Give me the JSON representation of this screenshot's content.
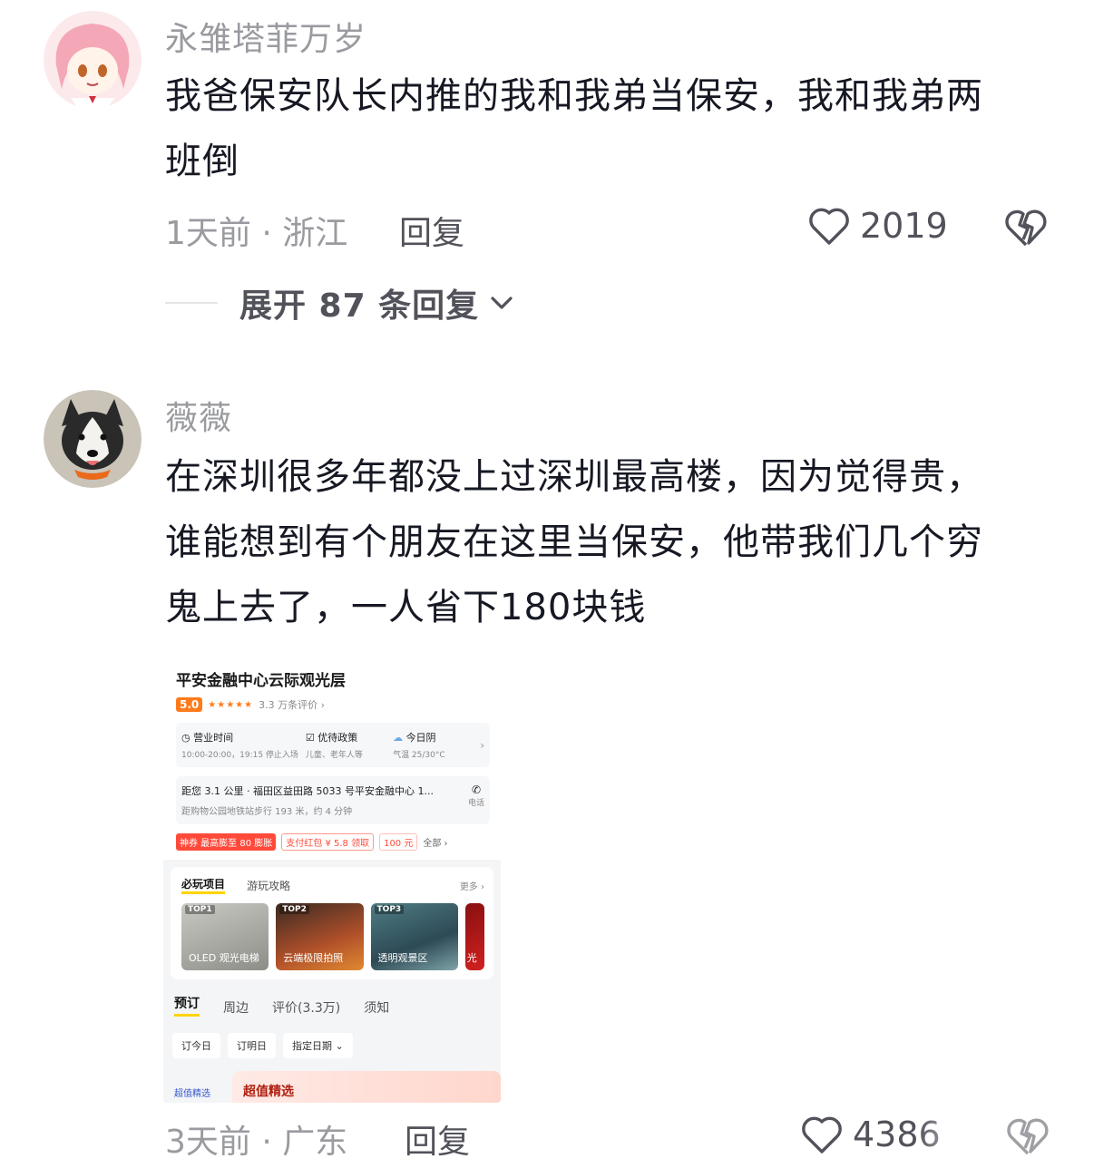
{
  "comments": [
    {
      "username": "永雏塔菲万岁",
      "text_line1": "我爸保安队长内推的我和我弟当保安，我和我弟两",
      "text_line2": "班倒",
      "meta": "1天前 · 浙江",
      "reply_label": "回复",
      "likes": "2019",
      "expand_label": "展开 87 条回复"
    },
    {
      "username": "薇薇",
      "text_line1": "在深圳很多年都没上过深圳最高楼，因为觉得贵，",
      "text_line2": "谁能想到有个朋友在这里当保安，他带我们几个穷",
      "text_line3": "鬼上去了，一人省下180块钱",
      "meta": "3天前 · 广东",
      "reply_label": "回复",
      "likes": "4386"
    }
  ],
  "screenshot": {
    "title": "平安金融中心云际观光层",
    "score": "5.0",
    "reviews": "3.3 万条评价 ›",
    "hours_title": "营业时间",
    "hours_sub": "10:00-20:00，19:15 停止入场",
    "policy_title": "优待政策",
    "policy_sub": "儿童、老年人等",
    "weather_title": "今日阴",
    "weather_sub": "气温 25/30°C",
    "address": "距您 3.1 公里 · 福田区益田路 5033 号平安金融中心 1...",
    "metro": "距购物公园地铁站步行 193 米，约 4 分钟",
    "phone_label": "电话",
    "coupon1": "神券 最高膨至 80  膨胀",
    "coupon2": "支付红包 ¥ 5.8  领取",
    "coupon3": "100 元",
    "coupon_all": "全部 ›",
    "tab_must": "必玩项目",
    "tab_guide": "游玩攻略",
    "more": "更多 ›",
    "thumbs": [
      {
        "tag": "TOP1",
        "caption": "OLED 观光电梯"
      },
      {
        "tag": "TOP2",
        "caption": "云端极限拍照"
      },
      {
        "tag": "TOP3",
        "caption": "透明观景区"
      },
      {
        "tag": "",
        "caption": "光"
      }
    ],
    "tab_book": "预订",
    "tab_around": "周边",
    "tab_review": "评价(3.3万)",
    "tab_notice": "须知",
    "date_today": "订今日",
    "date_tomorrow": "订明日",
    "date_pick": "指定日期 ⌄",
    "deal_side": "超值精选",
    "deal_title": "超值精选"
  },
  "colors": {
    "meta_gray": "#9a9ba0",
    "text_dark": "#161823",
    "action_gray": "#51525a"
  }
}
